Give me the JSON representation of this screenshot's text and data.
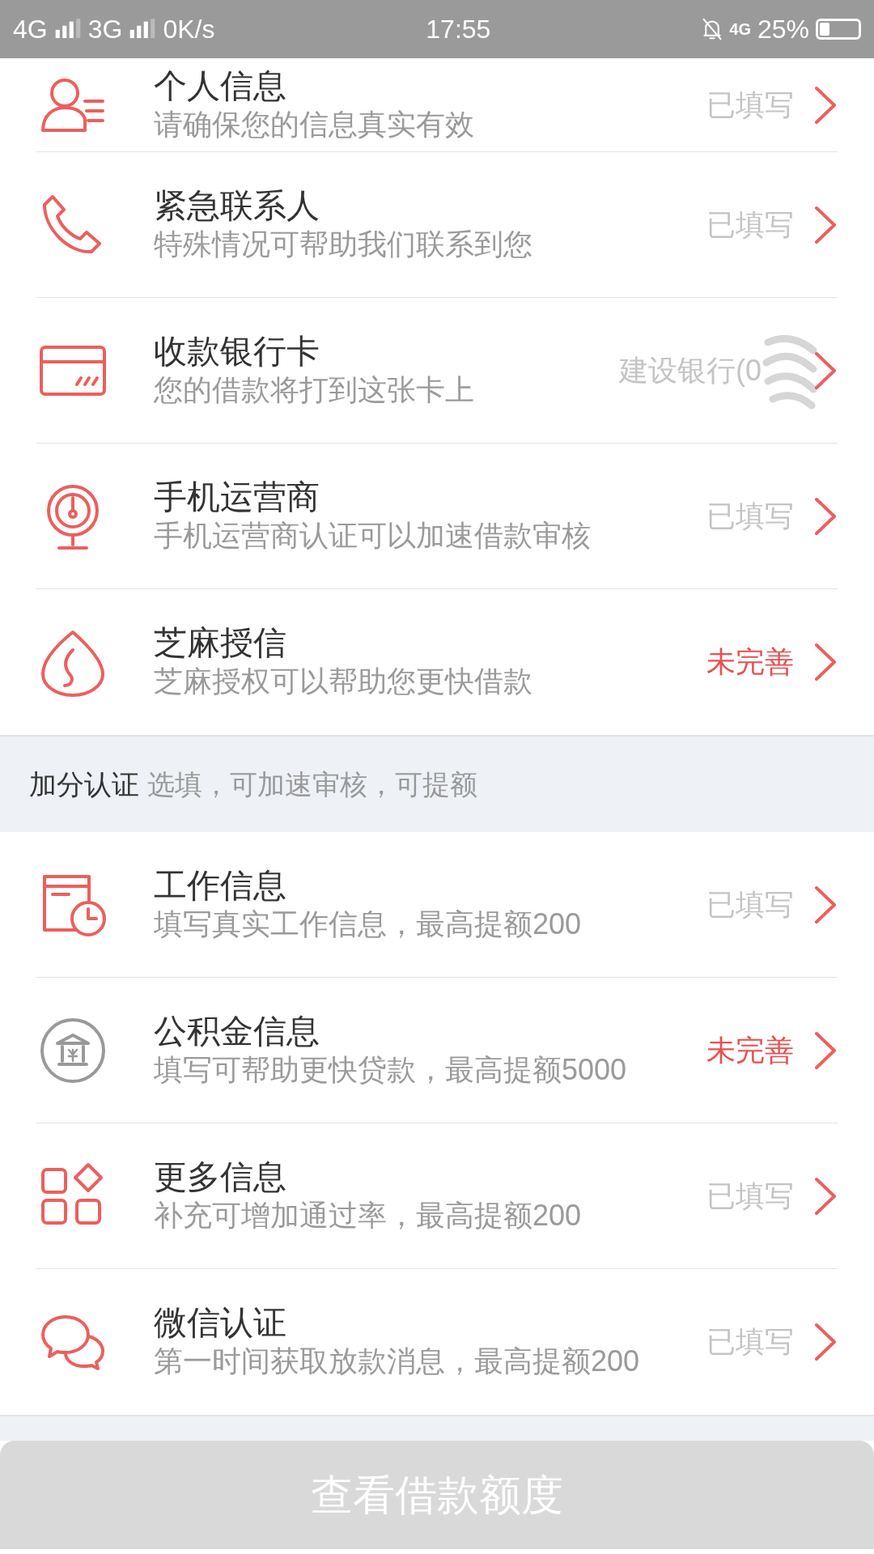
{
  "status_bar": {
    "left": [
      {
        "text": "4G",
        "signal": true
      },
      {
        "text": "3G",
        "signal": true
      },
      {
        "text": "0K/s",
        "signal": false
      }
    ],
    "time": "17:55",
    "network": "4G",
    "battery_text": "25%",
    "battery": {
      "level": 0.25
    }
  },
  "required_items": [
    {
      "title": "个人信息",
      "subtitle": "请确保您的信息真实有效",
      "value": "已填写",
      "complete": true,
      "redacted": false
    },
    {
      "title": "紧急联系人",
      "subtitle": "特殊情况可帮助我们联系到您",
      "value": "已填写",
      "complete": true,
      "redacted": false
    },
    {
      "title": "收款银行卡",
      "subtitle": "您的借款将打到这张卡上",
      "value": "建设银行(0",
      "complete": true,
      "redacted": true
    },
    {
      "title": "手机运营商",
      "subtitle": "手机运营商认证可以加速借款审核",
      "value": "已填写",
      "complete": true,
      "redacted": false
    },
    {
      "title": "芝麻授信",
      "subtitle": "芝麻授权可以帮助您更快借款",
      "value": "未完善",
      "complete": false,
      "redacted": false
    }
  ],
  "bonus_section": {
    "title": "加分认证",
    "note": "选填，可加速审核，可提额"
  },
  "bonus_items": [
    {
      "title": "工作信息",
      "subtitle": "填写真实工作信息，最高提额200",
      "value": "已填写",
      "complete": true,
      "redacted": false
    },
    {
      "title": "公积金信息",
      "subtitle": "填写可帮助更快贷款，最高提额5000",
      "value": "未完善",
      "complete": false,
      "redacted": false
    },
    {
      "title": "更多信息",
      "subtitle": "补充可增加通过率，最高提额200",
      "value": "已填写",
      "complete": true,
      "redacted": false
    },
    {
      "title": "微信认证",
      "subtitle": "第一时间获取放款消息，最高提额200",
      "value": "已填写",
      "complete": true,
      "redacted": false
    }
  ],
  "submit_button": {
    "label": "查看借款额度",
    "disabled": true
  }
}
